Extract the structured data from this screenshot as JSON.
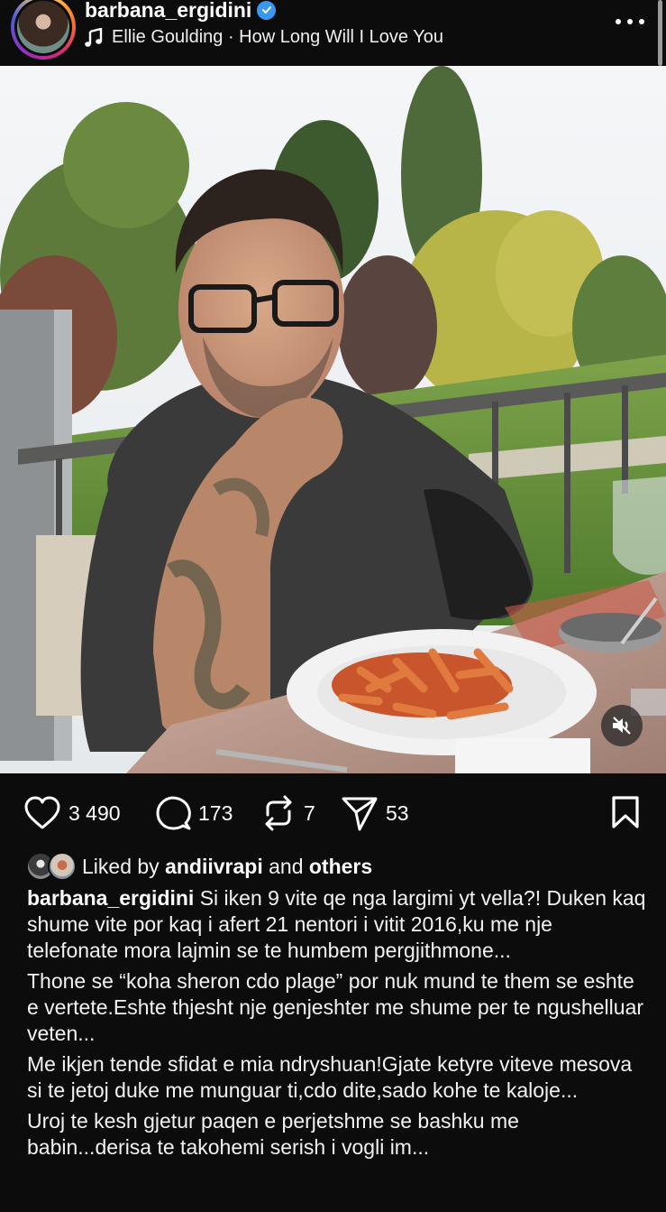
{
  "header": {
    "username": "barbana_ergidini",
    "song": "Ellie Goulding · How Long Will I Love You"
  },
  "actions": {
    "likes_count": "3 490",
    "comments_count": "173",
    "reposts_count": "7",
    "shares_count": "53"
  },
  "likes": {
    "prefix": "Liked by",
    "user": "andiivrapi",
    "connector": "and",
    "others": "others"
  },
  "caption": {
    "username": "barbana_ergidini",
    "p1": "Si iken 9 vite qe nga largimi yt vella?! Duken kaq shume vite por kaq i afert 21 nentori i vitit 2016,ku me nje telefonate mora lajmin se te humbem pergjithmone...",
    "p2": "Thone se “koha sheron cdo plage” por nuk mund te them se eshte e vertete.Eshte thjesht nje genjeshter me shume per te ngushelluar veten...",
    "p3": "Me ikjen tende sfidat e mia ndryshuan!Gjate ketyre viteve mesova si te jetoj duke me munguar ti,cdo dite,sado kohe te kaloje...",
    "p4": "Uroj te kesh gjetur paqen e perjetshme se bashku me babin...derisa te takohemi serish i vogli im..."
  },
  "colors": {
    "background": "#0c0c0c",
    "verified": "#3897f0",
    "text": "#f5f5f5"
  },
  "icons": [
    "music-note-icon",
    "verified-badge-icon",
    "more-options-icon",
    "muted-speaker-icon",
    "heart-icon",
    "comment-icon",
    "repost-icon",
    "share-icon",
    "bookmark-icon"
  ]
}
